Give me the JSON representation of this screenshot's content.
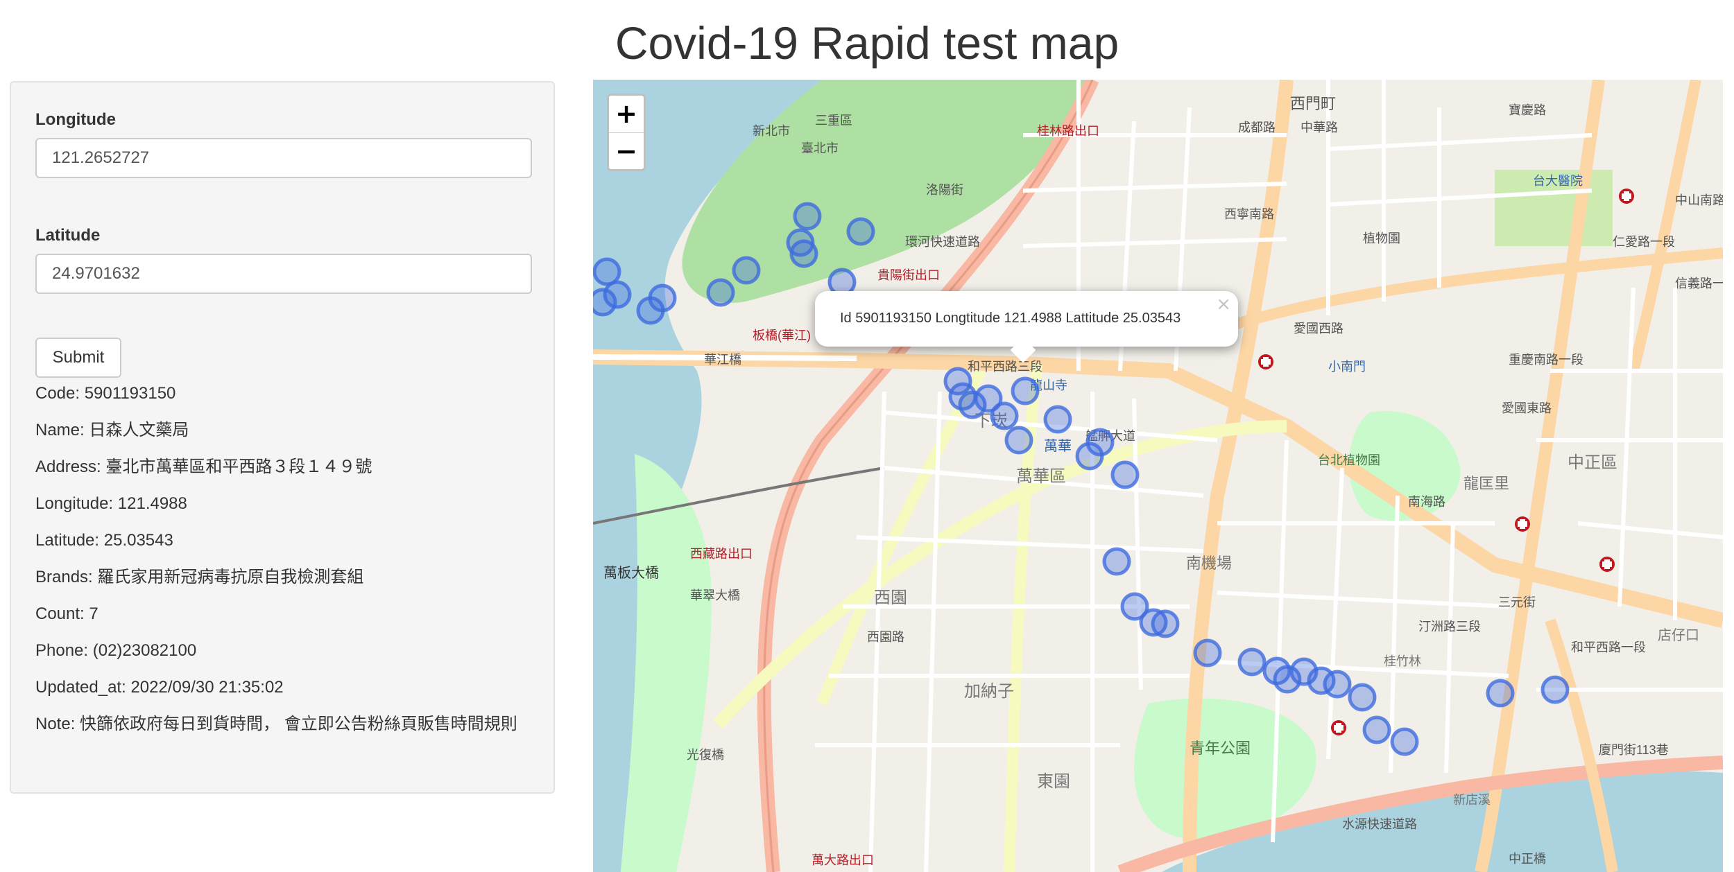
{
  "page": {
    "title": "Covid-19 Rapid test map"
  },
  "form": {
    "longitude_label": "Longitude",
    "longitude_value": "121.2652727",
    "latitude_label": "Latitude",
    "latitude_value": "24.9701632",
    "submit_label": "Submit"
  },
  "details": {
    "code": "Code: 5901193150",
    "name": "Name: 日森人文藥局",
    "address": "Address: 臺北市萬華區和平西路３段１４９號",
    "longitude": "Longitude: 121.4988",
    "latitude": "Latitude: 25.03543",
    "brands": "Brands: 羅氏家用新冠病毒抗原自我檢測套組",
    "count": "Count: 7",
    "phone": "Phone: (02)23082100",
    "updated_at": "Updated_at: 2022/09/30 21:35:02",
    "note": "Note: 快篩依政府每日到貨時間， 會立即公告粉絲頁販售時間規則"
  },
  "map": {
    "zoom_in": "+",
    "zoom_out": "−",
    "popup_text": "Id 5901193150 Longtitude 121.4988 Lattitude 25.03543",
    "popup_close": "×",
    "marker_color": "#3f6bdf",
    "water_color": "#aad3df",
    "park_color": "#aedfa3",
    "labels": [
      "新北市",
      "臺北市",
      "三重區",
      "桂林路出口",
      "西門町",
      "中華路",
      "成都路",
      "西寧南路",
      "環河快速道路",
      "貴陽街出口",
      "板橋(華江)",
      "華江橋",
      "和平西路三段",
      "龍山寺",
      "萬華",
      "艋舺大道",
      "萬華區",
      "下崁",
      "愛國西路",
      "小南門",
      "台北植物園",
      "中正區",
      "龍匡里",
      "南機場",
      "青年公園",
      "加納子",
      "東園",
      "西園",
      "萬板大橋",
      "西藏路出口",
      "華翠大橋",
      "光復橋",
      "萬大路出口",
      "水源快速道路",
      "台大醫院",
      "植物園",
      "桂竹林",
      "汀洲路三段",
      "和平西路一段",
      "南海路",
      "愛國東路",
      "三元街",
      "重慶南路一段",
      "中山南路",
      "信義路一段",
      "仁愛路一段",
      "寶慶路",
      "店仔口",
      "新店溪",
      "中正橋",
      "廈門街113巷",
      "洛陽街",
      "西園路"
    ]
  }
}
